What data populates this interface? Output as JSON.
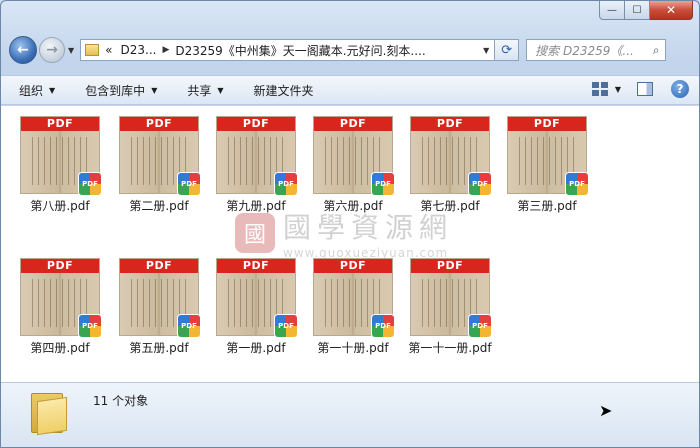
{
  "window": {
    "minimize_glyph": "—",
    "maximize_glyph": "☐",
    "close_glyph": "✕"
  },
  "nav": {
    "back_glyph": "←",
    "forward_glyph": "→",
    "breadcrumb_overflow": "«",
    "breadcrumb": [
      "D23...",
      "D23259《中州集》天一阁藏本.元好问.刻本...."
    ],
    "search_placeholder": "搜索 D23259《..."
  },
  "toolbar": {
    "items": [
      "组织",
      "包含到库中",
      "共享",
      "新建文件夹"
    ],
    "help_glyph": "?"
  },
  "icons": {
    "pdf_banner": "PDF",
    "pdf_badge": "PDF"
  },
  "files": [
    {
      "name": "第八册.pdf"
    },
    {
      "name": "第二册.pdf"
    },
    {
      "name": "第九册.pdf"
    },
    {
      "name": "第六册.pdf"
    },
    {
      "name": "第七册.pdf"
    },
    {
      "name": "第三册.pdf"
    },
    {
      "name": "第四册.pdf"
    },
    {
      "name": "第五册.pdf"
    },
    {
      "name": "第一册.pdf"
    },
    {
      "name": "第一十册.pdf"
    },
    {
      "name": "第一十一册.pdf"
    }
  ],
  "watermark": {
    "seal": "國",
    "text": "國學資源網",
    "url": "www.guoxueziyuan.com"
  },
  "status": {
    "count_text": "11 个对象"
  }
}
